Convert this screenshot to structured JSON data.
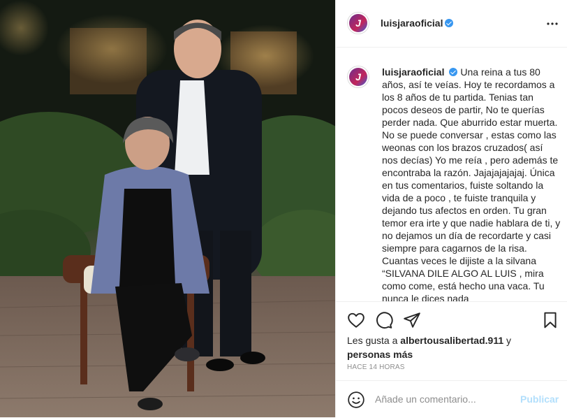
{
  "post": {
    "username": "luisjaraoficial",
    "avatar_letter": "J",
    "caption_text": "Una reina a tus 80 años, así te veías. Hoy te recordamos a los 8 años de tu partida. Tenias tan pocos deseos de partir, No te querías perder nada. Que aburrido estar muerta. No se puede conversar , estas como las weonas con los brazos cruzados( así nos decías) Yo me reía , pero además te encontraba la razón. Jajajajajajaj. Única en tus comentarios, fuiste soltando la vida de a poco , te fuiste tranquila y dejando tus afectos en orden. Tu gran temor era irte y que nadie hablara de ti, y no dejamos un día de recordarte y casi siempre para cagarnos de la risa. Cuantas veces le dijiste a la silvana “SILVANA DILE ALGO AL LUIS , mira como come, está hecho una vaca. Tu nunca le dices nada"
  },
  "likes": {
    "prefix": "Les gusta a ",
    "user": "albertousalibertad.911",
    "connector": " y",
    "others": "personas más"
  },
  "timestamp": "HACE 14 HORAS",
  "comment": {
    "placeholder": "Añade un comentario...",
    "publish_label": "Publicar"
  },
  "icons": {
    "like": "heart-icon",
    "comment": "comment-icon",
    "share": "paper-plane-icon",
    "save": "bookmark-icon",
    "emoji": "emoji-icon",
    "verified": "verified-badge-icon"
  },
  "colors": {
    "verified": "#3897f0",
    "publish_disabled": "#b2dffc",
    "secondary_text": "#8e8e8e"
  }
}
